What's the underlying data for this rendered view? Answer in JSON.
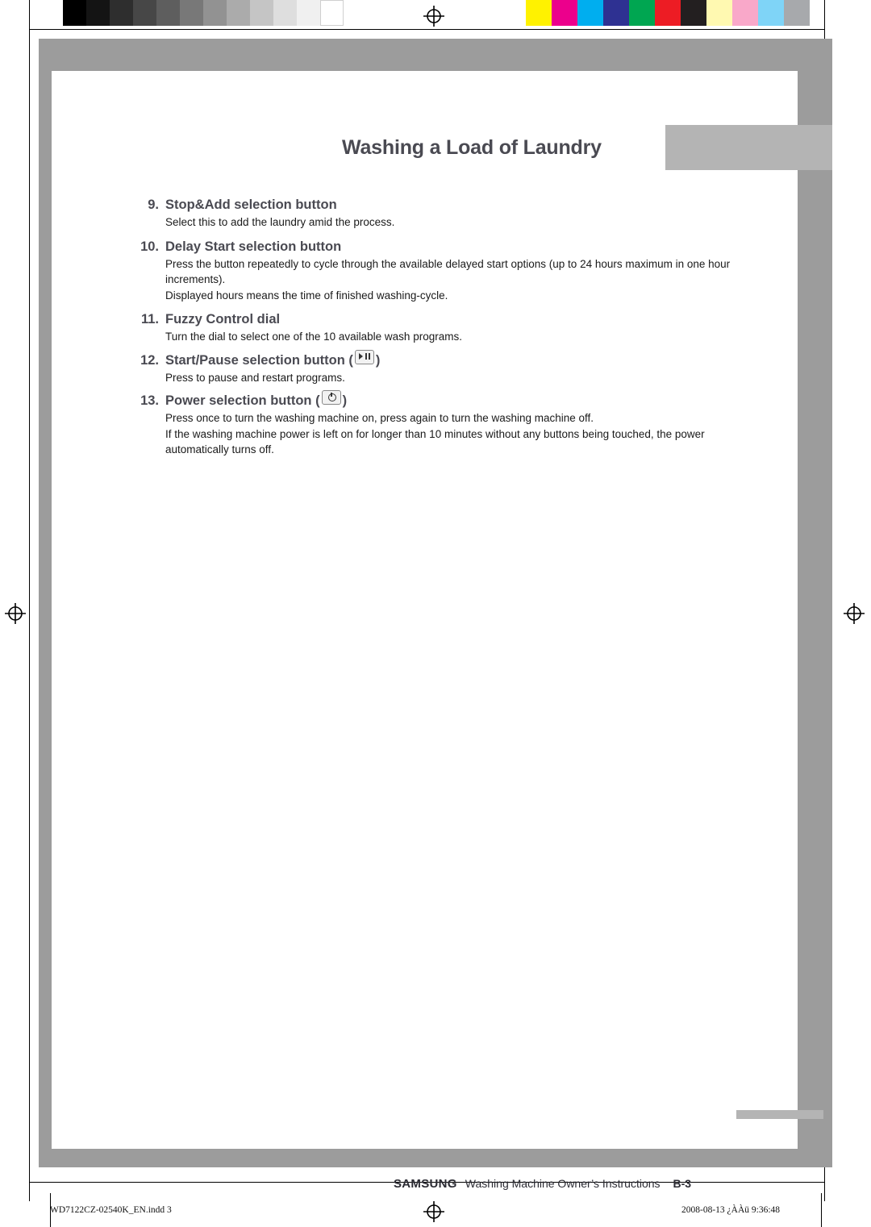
{
  "header": {
    "title": "Washing a Load of Laundry"
  },
  "items": [
    {
      "num": "9.",
      "title": "Stop&Add selection button",
      "icon": null,
      "paragraphs": [
        "Select this to add the laundry amid the process."
      ]
    },
    {
      "num": "10.",
      "title": "Delay Start selection button",
      "icon": null,
      "paragraphs": [
        "Press the button repeatedly to cycle through the available delayed start options (up to 24 hours maximum in one hour increments).",
        "Displayed hours means the time of finished washing-cycle."
      ]
    },
    {
      "num": "11.",
      "title": "Fuzzy Control dial",
      "icon": null,
      "paragraphs": [
        "Turn the dial to select one of the 10 available wash programs."
      ]
    },
    {
      "num": "12.",
      "title": "Start/Pause selection button (",
      "title_tail": ")",
      "icon": "start-pause-button-icon",
      "paragraphs": [
        "Press to pause and restart programs."
      ]
    },
    {
      "num": "13.",
      "title": "Power selection button (",
      "title_tail": ")",
      "icon": "power-button-icon",
      "paragraphs": [
        "Press once to turn the washing machine on, press again to turn the washing machine off.",
        "If the washing machine power is left on for longer than 10 minutes without any buttons being touched, the power automatically turns off."
      ]
    }
  ],
  "footer": {
    "brand": "SAMSUNG",
    "text": "Washing Machine Owner’s Instructions",
    "page": "B-3"
  },
  "print_info": {
    "left": "WD7122CZ-02540K_EN.indd   3",
    "right": "2008-08-13   ¿ÀÀü 9:36:48"
  },
  "colorbars": {
    "grayscale": [
      "#000000",
      "#1c1c1c",
      "#333333",
      "#4a4a4a",
      "#616161",
      "#7a7a7a",
      "#949494",
      "#ababab",
      "#c4c4c4",
      "#dddddd",
      "#f2f2f2",
      "#ffffff"
    ],
    "process": [
      "#fff200",
      "#ec008c",
      "#00aeef",
      "#2e3192",
      "#00a651",
      "#ed1c24",
      "#231f20",
      "#fff9b1",
      "#f9a8c9",
      "#7fd4f7",
      "#a7a9ac"
    ]
  }
}
